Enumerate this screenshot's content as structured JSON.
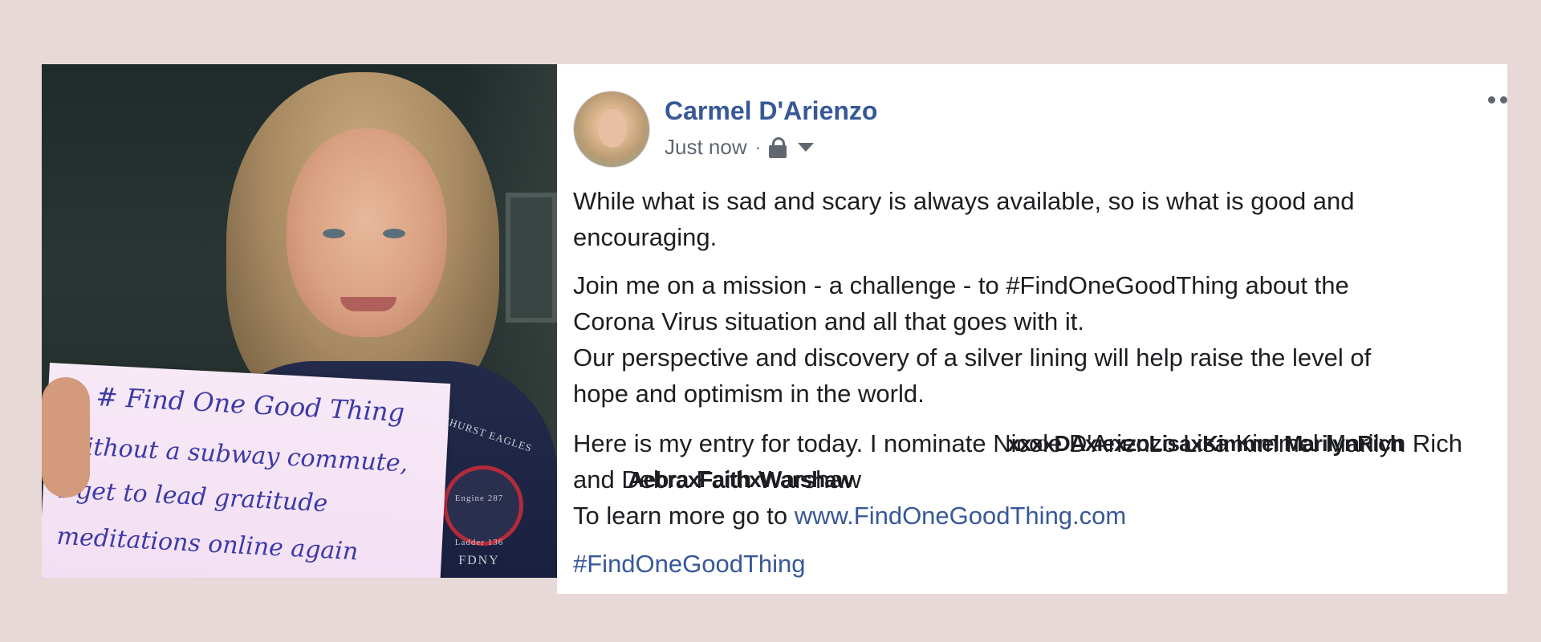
{
  "photo": {
    "sign_lines": [
      "# Find One Good Thing",
      "Without a subway commute,",
      "I get to lead gratitude",
      "meditations online again"
    ],
    "patch": {
      "top_text": "ELMHURST EAGLES",
      "engine": "Engine 287",
      "ladder": "Ladder 136",
      "bottom_text": "FDNY"
    }
  },
  "post": {
    "author": "Carmel D'Arienzo",
    "timestamp": "Just now",
    "separator": "·",
    "paragraph1_line1": "While what is sad and scary is always available, so is what is good and",
    "paragraph1_line2": "encouraging.",
    "paragraph2_line1": "Join me on a mission - a challenge - to #FindOneGoodThing about the",
    "paragraph2_line2": "Corona Virus situation and all that goes with it.",
    "paragraph2_line3": "Our perspective and discovery of a silver lining will help raise the level of",
    "paragraph2_line4": "hope and optimism in the world.",
    "nominate_prefix": "Here is my entry for today. I nominate ",
    "nominate_names_1": "Nicole D'Arienzo Lisa Kimmel Marilyn Rich",
    "nominate_overlay_1": "xxxxDAxiexzoLisaxKimmel MarilynRich",
    "and_prefix": "and ",
    "nominate_names_2": "Debra Faith Warshaw",
    "nominate_overlay_2": "AebraxFaithxWarshaw",
    "learn_prefix": "To learn more go to ",
    "link": "www.FindOneGoodThing.com",
    "hashtag": "#FindOneGoodThing"
  },
  "colors": {
    "background": "#e7d9d8",
    "link": "#385898",
    "text": "#1c1e21",
    "meta": "#606770"
  },
  "icons": [
    "lock-icon",
    "chevron-down-icon",
    "more-icon"
  ]
}
